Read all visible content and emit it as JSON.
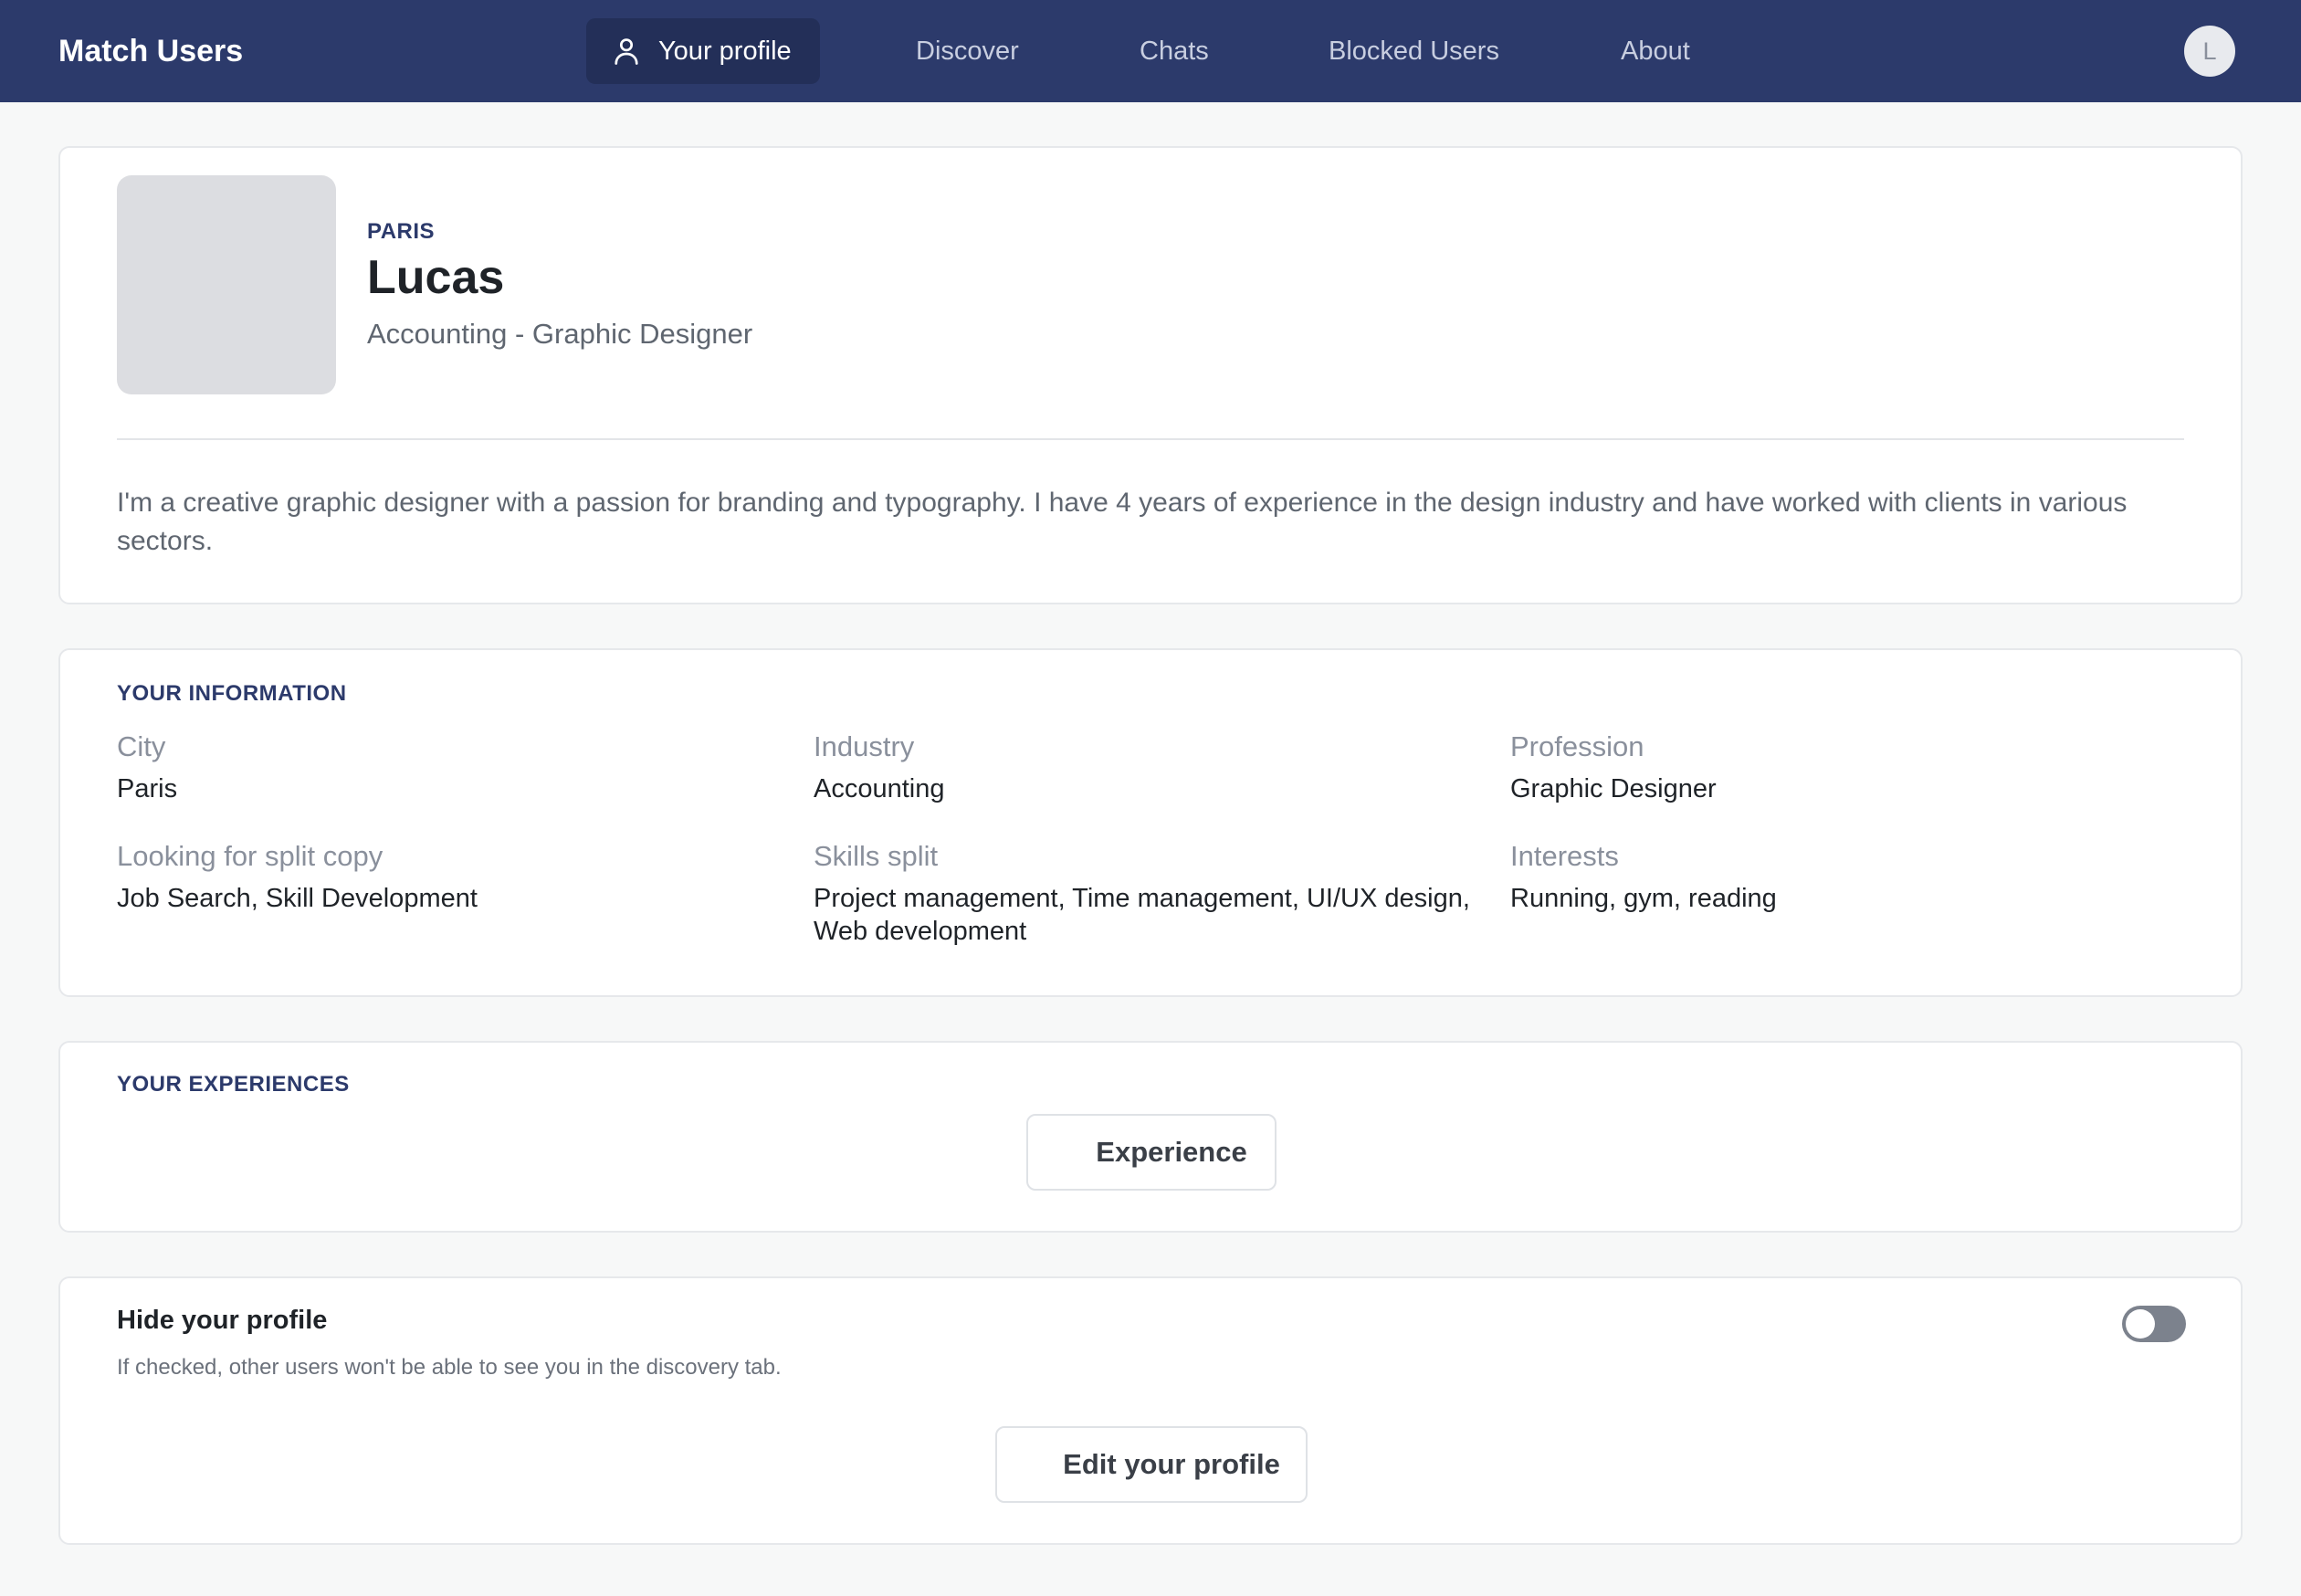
{
  "app": {
    "title": "Match Users"
  },
  "nav": {
    "active": {
      "label": "Your profile",
      "icon": "user-icon"
    },
    "items": [
      "Discover",
      "Chats",
      "Blocked Users",
      "About"
    ],
    "avatar_initial": "L"
  },
  "profile": {
    "location": "PARIS",
    "name": "Lucas",
    "subtitle": "Accounting - Graphic Designer",
    "bio": "I'm a creative graphic designer with a passion for branding and typography. I have 4 years of experience in the design industry and have worked with clients in various sectors."
  },
  "info": {
    "title": "YOUR INFORMATION",
    "fields": [
      {
        "label": "City",
        "value": "Paris"
      },
      {
        "label": "Industry",
        "value": "Accounting"
      },
      {
        "label": "Profession",
        "value": "Graphic Designer"
      },
      {
        "label": "Looking for split copy",
        "value": "Job Search, Skill Development"
      },
      {
        "label": "Skills split",
        "value": "Project management, Time management, UI/UX design, Web development"
      },
      {
        "label": "Interests",
        "value": "Running, gym, reading"
      }
    ]
  },
  "experiences": {
    "title": "YOUR EXPERIENCES",
    "button_label": "Experience"
  },
  "visibility": {
    "title": "Hide your profile",
    "description": "If checked, other users won't be able to see you in the discovery tab.",
    "hidden": false,
    "edit_label": "Edit your profile"
  },
  "colors": {
    "nav_bg": "#2c3a6b",
    "accent": "#2c3a6b",
    "page_bg": "#f7f8f8"
  }
}
